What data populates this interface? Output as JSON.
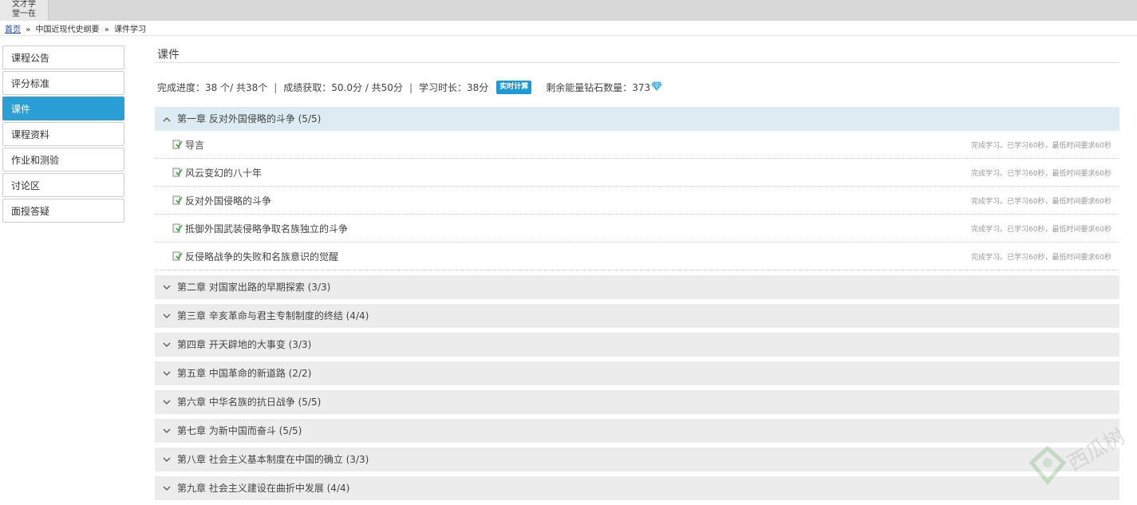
{
  "topbar": {
    "logo_line1": "文才学",
    "logo_line2": "堂一在"
  },
  "breadcrumb": {
    "home": "首页",
    "sep": "»",
    "course": "中国近现代史纲要",
    "current": "课件学习"
  },
  "sidebar": {
    "items": [
      {
        "label": "课程公告",
        "active": false
      },
      {
        "label": "评分标准",
        "active": false
      },
      {
        "label": "课件",
        "active": true
      },
      {
        "label": "课程资料",
        "active": false
      },
      {
        "label": "作业和测验",
        "active": false
      },
      {
        "label": "讨论区",
        "active": false
      },
      {
        "label": "面授答疑",
        "active": false
      }
    ]
  },
  "main": {
    "title": "课件",
    "stats": {
      "progress": "完成进度：38 个/ 共38个",
      "separator": "|",
      "score": "成绩获取：50.0分 / 共50分",
      "study_time": "学习时长：38分",
      "calc_button": "实时计算",
      "diamonds": "剩余能量钻石数量：373"
    },
    "chapters": [
      {
        "title": "第一章 反对外国侵略的斗争 (5/5)",
        "expanded": true,
        "lessons": [
          {
            "title": "导言",
            "status": "完成学习。已学习60秒，最低时间要求60秒"
          },
          {
            "title": "风云变幻的八十年",
            "status": "完成学习。已学习60秒，最低时间要求60秒"
          },
          {
            "title": "反对外国侵略的斗争",
            "status": "完成学习。已学习60秒，最低时间要求60秒"
          },
          {
            "title": "抵御外国武装侵略争取名族独立的斗争",
            "status": "完成学习。已学习60秒，最低时间要求60秒"
          },
          {
            "title": "反侵略战争的失败和名族意识的觉醒",
            "status": "完成学习。已学习60秒，最低时间要求60秒"
          }
        ]
      },
      {
        "title": "第二章 对国家出路的早期探索 (3/3)",
        "expanded": false
      },
      {
        "title": "第三章 辛亥革命与君主专制制度的终结 (4/4)",
        "expanded": false
      },
      {
        "title": "第四章 开天辟地的大事变 (3/3)",
        "expanded": false
      },
      {
        "title": "第五章 中国革命的新道路 (2/2)",
        "expanded": false
      },
      {
        "title": "第六章 中华名族的抗日战争 (5/5)",
        "expanded": false
      },
      {
        "title": "第七章 为新中国而奋斗 (5/5)",
        "expanded": false
      },
      {
        "title": "第八章 社会主义基本制度在中国的确立 (3/3)",
        "expanded": false
      },
      {
        "title": "第九章 社会主义建设在曲折中发展 (4/4)",
        "expanded": false
      }
    ]
  },
  "watermark": {
    "text": "西瓜树"
  },
  "colors": {
    "accent": "#2a9fd6",
    "chapter_open_bg": "#dcecf2",
    "chapter_bg": "#ececec",
    "link": "#1a3ea8"
  },
  "icons": {
    "expanded": "chevron-up-icon",
    "collapsed": "chevron-down-icon",
    "lesson": "document-check-icon",
    "diamond": "diamond-icon"
  }
}
